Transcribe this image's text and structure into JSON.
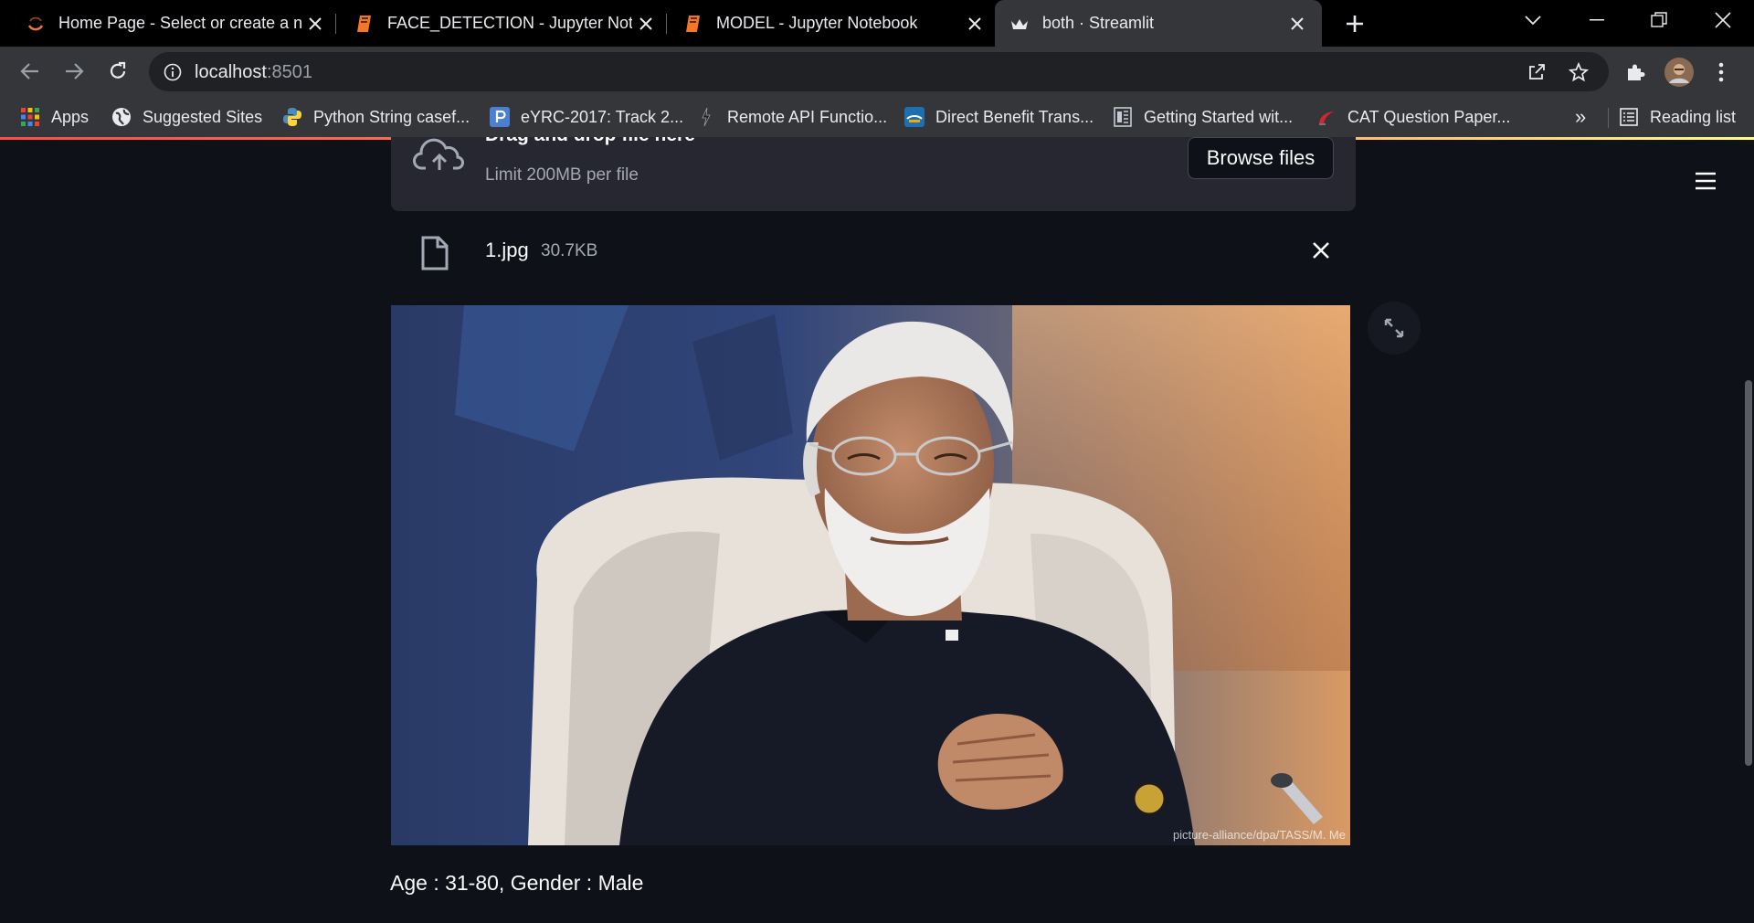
{
  "tabs": [
    {
      "title": "Home Page - Select or create a n",
      "icon": "jupyter-spinner-icon",
      "active": false
    },
    {
      "title": "FACE_DETECTION - Jupyter Notel",
      "icon": "notebook-icon",
      "active": false
    },
    {
      "title": "MODEL - Jupyter Notebook",
      "icon": "notebook-icon",
      "active": false
    },
    {
      "title": "both · Streamlit",
      "icon": "streamlit-crown-icon",
      "active": true
    }
  ],
  "address": {
    "host": "localhost",
    "port": ":8501"
  },
  "bookmarks": [
    {
      "label": "Apps",
      "icon": "apps-grid-icon"
    },
    {
      "label": "Suggested Sites",
      "icon": "globe-icon"
    },
    {
      "label": "Python String casef...",
      "icon": "python-icon"
    },
    {
      "label": "eYRC-2017: Track 2...",
      "icon": "p-icon"
    },
    {
      "label": "Remote API Functio...",
      "icon": "bolt-icon"
    },
    {
      "label": "Direct Benefit Trans...",
      "icon": "dbt-icon"
    },
    {
      "label": "Getting Started wit...",
      "icon": "doc-icon"
    },
    {
      "label": "CAT Question Paper...",
      "icon": "cat-icon"
    }
  ],
  "bookmarks_more": "»",
  "reading_list": "Reading list",
  "uploader": {
    "title": "Drag and drop file here",
    "limit": "Limit 200MB per file",
    "browse_label": "Browse files"
  },
  "file": {
    "name": "1.jpg",
    "size": "30.7KB"
  },
  "photo_credit": "picture-alliance/dpa/TASS/M. Me",
  "result_text": "Age : 31-80, Gender : Male",
  "colors": {
    "background": "#0e1117",
    "panel": "#262730",
    "accent": "#ff4b4b"
  }
}
